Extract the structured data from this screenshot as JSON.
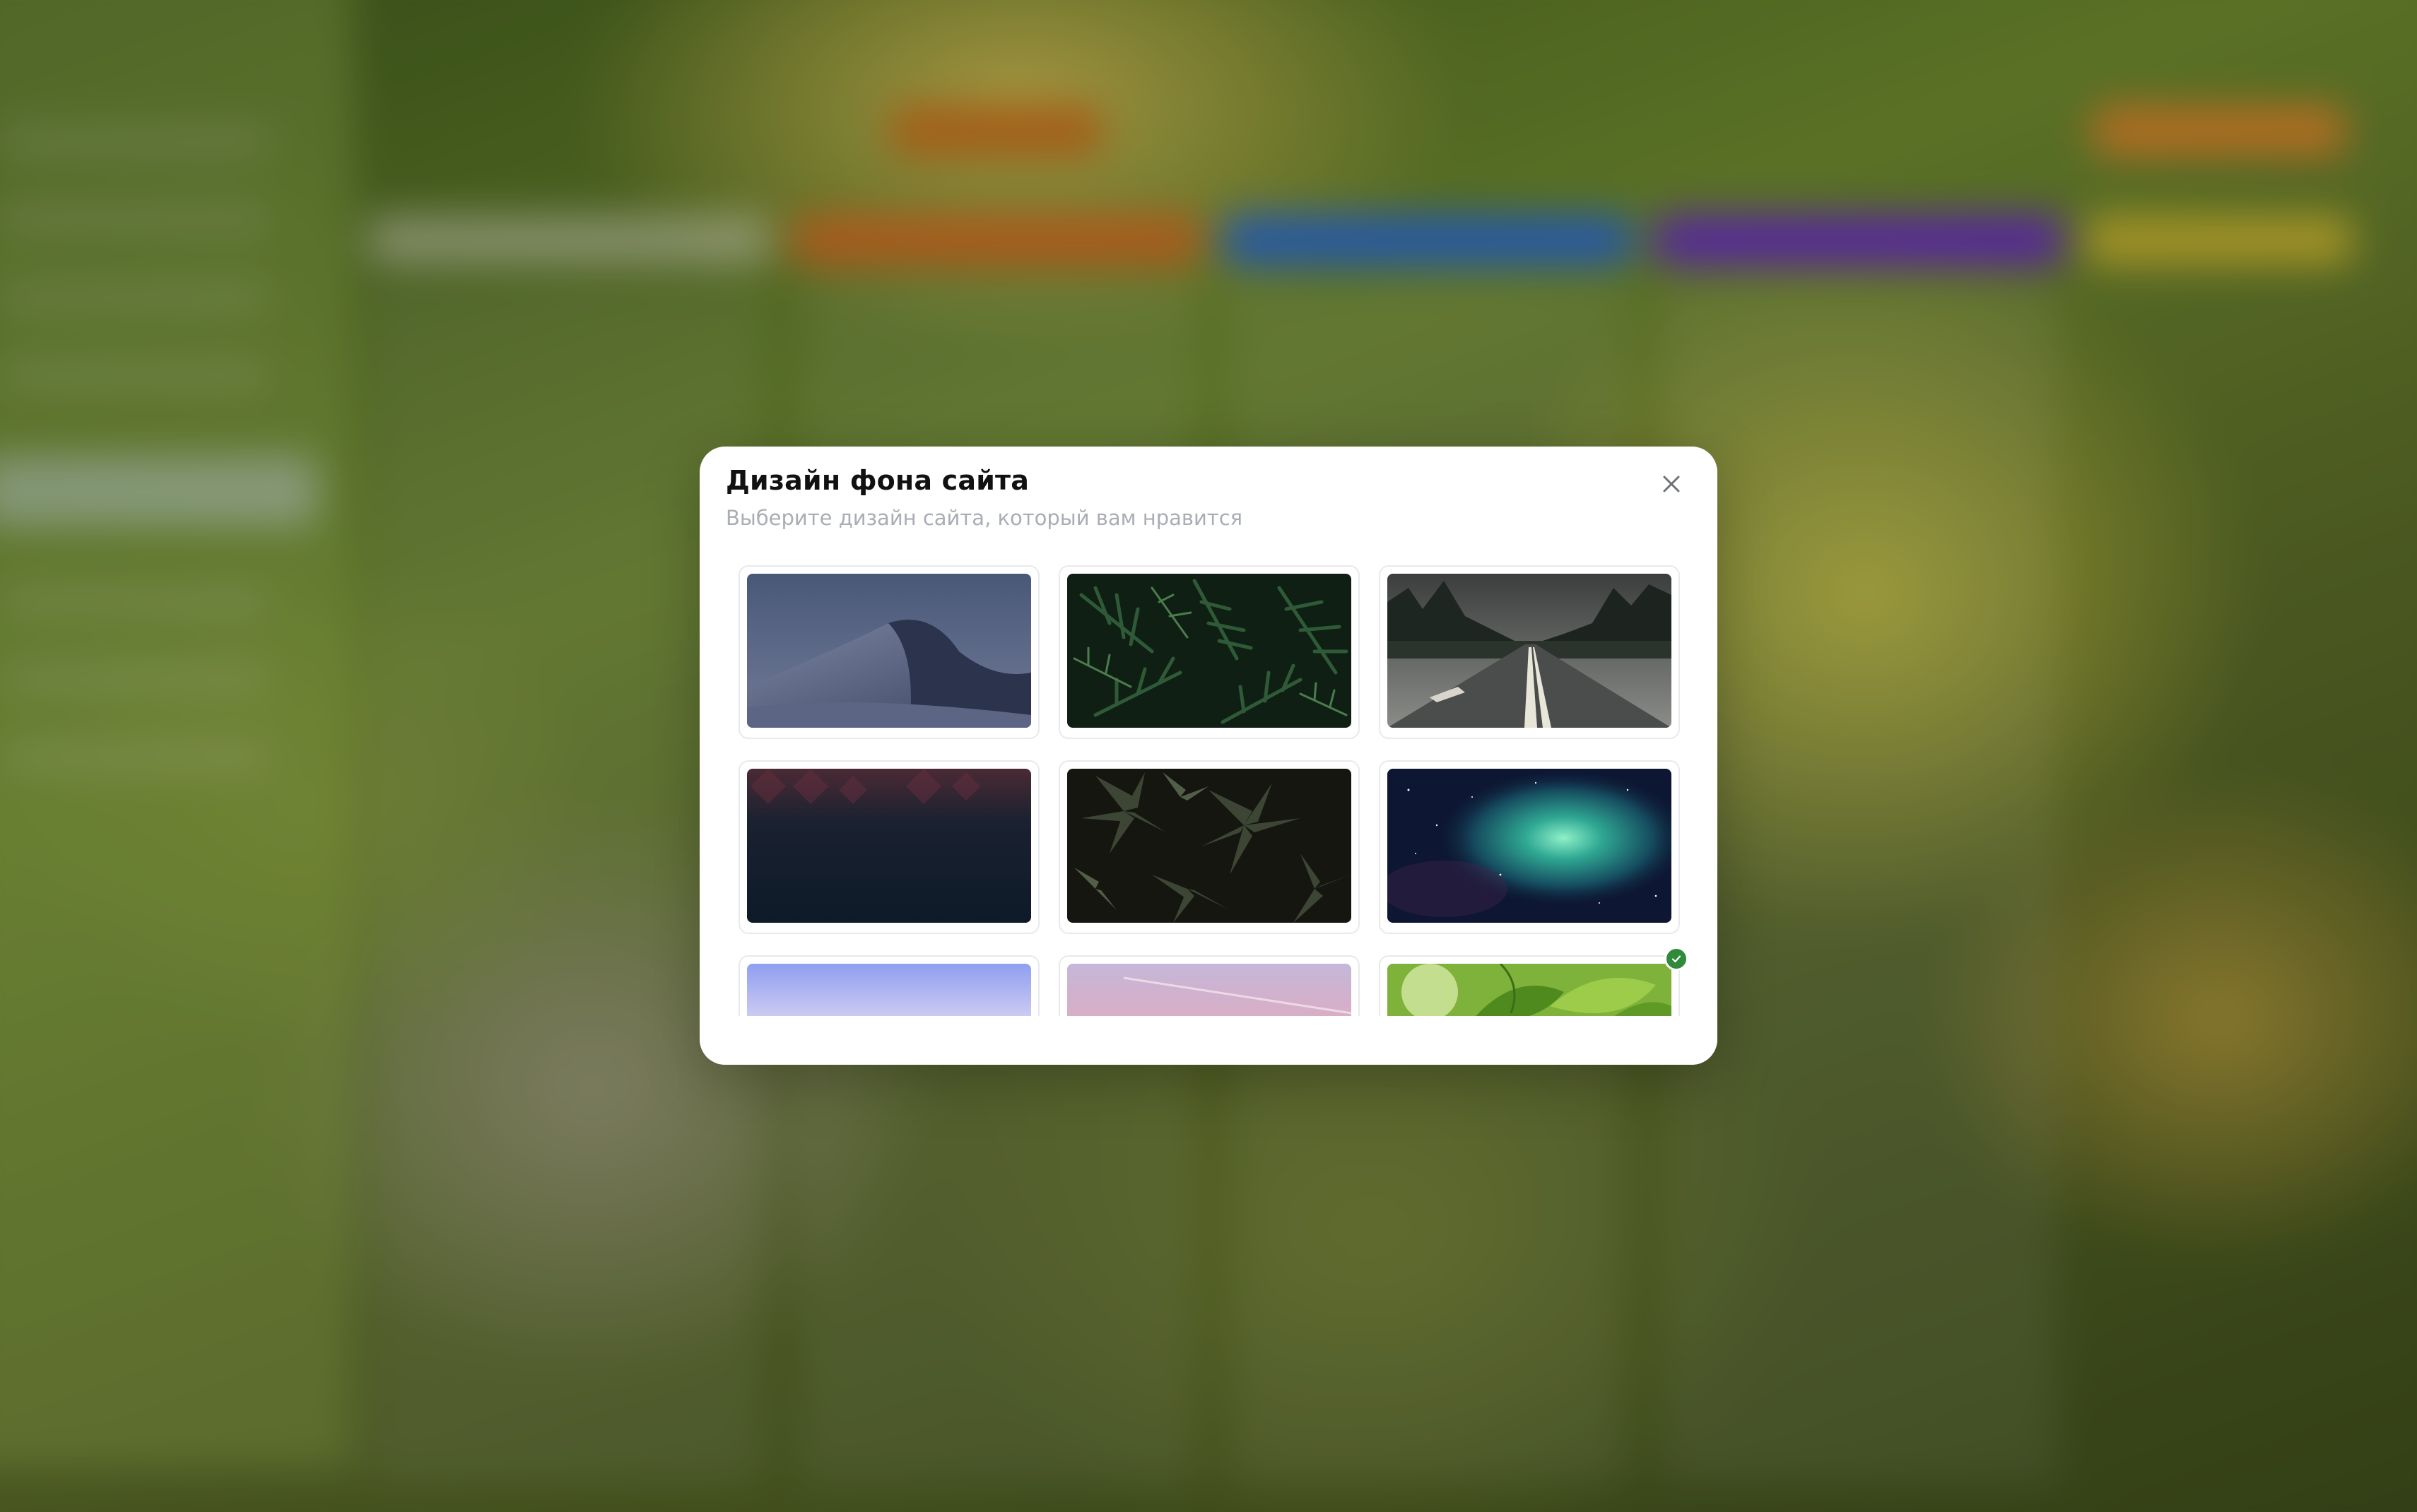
{
  "modal": {
    "title": "Дизайн фона сайта",
    "subtitle": "Выберите дизайн сайта, который вам нравится",
    "close_icon": "close-icon"
  },
  "backgrounds": [
    {
      "name": "desert-dunes-night",
      "selected": false
    },
    {
      "name": "fern-leaves",
      "selected": false
    },
    {
      "name": "forest-road",
      "selected": false
    },
    {
      "name": "dark-gradient",
      "selected": false
    },
    {
      "name": "dark-leaves",
      "selected": false
    },
    {
      "name": "nebula-space",
      "selected": false
    },
    {
      "name": "lavender-sky",
      "selected": false
    },
    {
      "name": "pink-sky",
      "selected": false
    },
    {
      "name": "green-leaves",
      "selected": true
    }
  ],
  "colors": {
    "selected_badge": "#2f8a3a",
    "subtitle": "#a9adb4",
    "tile_border": "#e8e9ec"
  }
}
